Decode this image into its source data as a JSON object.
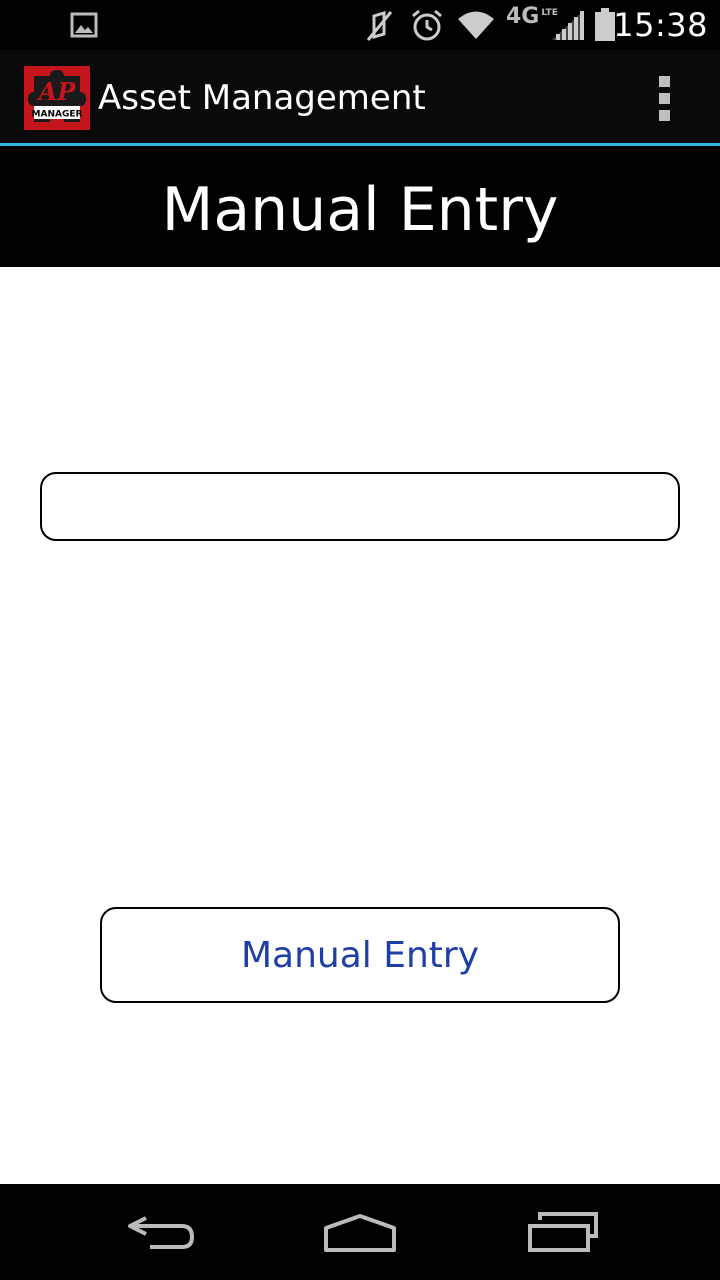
{
  "status_bar": {
    "time": "15:38",
    "network_label": "4G",
    "network_sub": "LTE",
    "icons": [
      "gallery-notification-icon",
      "mute-icon",
      "alarm-icon",
      "wifi-icon",
      "signal-icon",
      "battery-icon"
    ]
  },
  "action_bar": {
    "title": "Asset Management",
    "logo_text": "AP",
    "logo_caption": "MANAGER",
    "logo_color": "#c4151c",
    "overflow_icon": "overflow-menu-icon"
  },
  "header": {
    "title": "Manual Entry"
  },
  "form": {
    "input_value": "",
    "input_placeholder": "",
    "button_label": "Manual Entry"
  },
  "nav_bar": {
    "icons": [
      "back-icon",
      "home-icon",
      "recent-apps-icon"
    ]
  },
  "colors": {
    "accent_line": "#33b5e5",
    "button_text": "#1f3fa8"
  }
}
